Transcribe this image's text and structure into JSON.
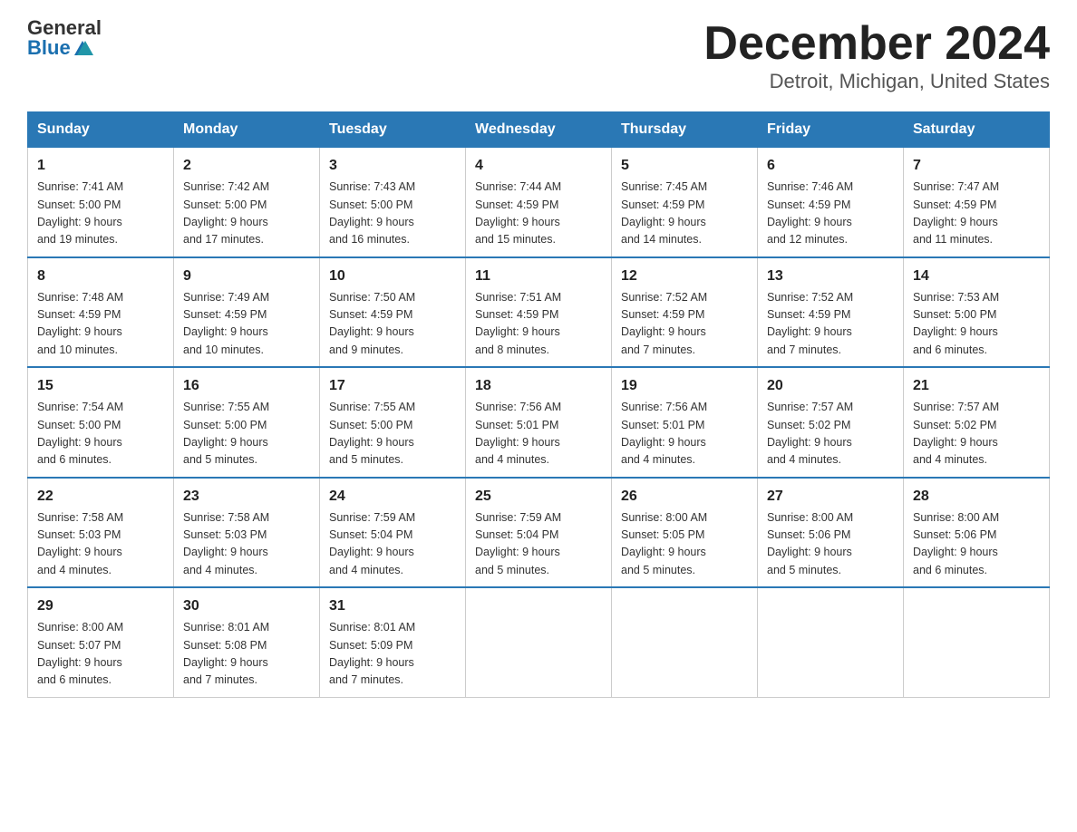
{
  "logo": {
    "general": "General",
    "blue": "Blue"
  },
  "title": "December 2024",
  "location": "Detroit, Michigan, United States",
  "days_of_week": [
    "Sunday",
    "Monday",
    "Tuesday",
    "Wednesday",
    "Thursday",
    "Friday",
    "Saturday"
  ],
  "weeks": [
    [
      {
        "day": "1",
        "sunrise": "7:41 AM",
        "sunset": "5:00 PM",
        "daylight": "9 hours and 19 minutes."
      },
      {
        "day": "2",
        "sunrise": "7:42 AM",
        "sunset": "5:00 PM",
        "daylight": "9 hours and 17 minutes."
      },
      {
        "day": "3",
        "sunrise": "7:43 AM",
        "sunset": "5:00 PM",
        "daylight": "9 hours and 16 minutes."
      },
      {
        "day": "4",
        "sunrise": "7:44 AM",
        "sunset": "4:59 PM",
        "daylight": "9 hours and 15 minutes."
      },
      {
        "day": "5",
        "sunrise": "7:45 AM",
        "sunset": "4:59 PM",
        "daylight": "9 hours and 14 minutes."
      },
      {
        "day": "6",
        "sunrise": "7:46 AM",
        "sunset": "4:59 PM",
        "daylight": "9 hours and 12 minutes."
      },
      {
        "day": "7",
        "sunrise": "7:47 AM",
        "sunset": "4:59 PM",
        "daylight": "9 hours and 11 minutes."
      }
    ],
    [
      {
        "day": "8",
        "sunrise": "7:48 AM",
        "sunset": "4:59 PM",
        "daylight": "9 hours and 10 minutes."
      },
      {
        "day": "9",
        "sunrise": "7:49 AM",
        "sunset": "4:59 PM",
        "daylight": "9 hours and 10 minutes."
      },
      {
        "day": "10",
        "sunrise": "7:50 AM",
        "sunset": "4:59 PM",
        "daylight": "9 hours and 9 minutes."
      },
      {
        "day": "11",
        "sunrise": "7:51 AM",
        "sunset": "4:59 PM",
        "daylight": "9 hours and 8 minutes."
      },
      {
        "day": "12",
        "sunrise": "7:52 AM",
        "sunset": "4:59 PM",
        "daylight": "9 hours and 7 minutes."
      },
      {
        "day": "13",
        "sunrise": "7:52 AM",
        "sunset": "4:59 PM",
        "daylight": "9 hours and 7 minutes."
      },
      {
        "day": "14",
        "sunrise": "7:53 AM",
        "sunset": "5:00 PM",
        "daylight": "9 hours and 6 minutes."
      }
    ],
    [
      {
        "day": "15",
        "sunrise": "7:54 AM",
        "sunset": "5:00 PM",
        "daylight": "9 hours and 6 minutes."
      },
      {
        "day": "16",
        "sunrise": "7:55 AM",
        "sunset": "5:00 PM",
        "daylight": "9 hours and 5 minutes."
      },
      {
        "day": "17",
        "sunrise": "7:55 AM",
        "sunset": "5:00 PM",
        "daylight": "9 hours and 5 minutes."
      },
      {
        "day": "18",
        "sunrise": "7:56 AM",
        "sunset": "5:01 PM",
        "daylight": "9 hours and 4 minutes."
      },
      {
        "day": "19",
        "sunrise": "7:56 AM",
        "sunset": "5:01 PM",
        "daylight": "9 hours and 4 minutes."
      },
      {
        "day": "20",
        "sunrise": "7:57 AM",
        "sunset": "5:02 PM",
        "daylight": "9 hours and 4 minutes."
      },
      {
        "day": "21",
        "sunrise": "7:57 AM",
        "sunset": "5:02 PM",
        "daylight": "9 hours and 4 minutes."
      }
    ],
    [
      {
        "day": "22",
        "sunrise": "7:58 AM",
        "sunset": "5:03 PM",
        "daylight": "9 hours and 4 minutes."
      },
      {
        "day": "23",
        "sunrise": "7:58 AM",
        "sunset": "5:03 PM",
        "daylight": "9 hours and 4 minutes."
      },
      {
        "day": "24",
        "sunrise": "7:59 AM",
        "sunset": "5:04 PM",
        "daylight": "9 hours and 4 minutes."
      },
      {
        "day": "25",
        "sunrise": "7:59 AM",
        "sunset": "5:04 PM",
        "daylight": "9 hours and 5 minutes."
      },
      {
        "day": "26",
        "sunrise": "8:00 AM",
        "sunset": "5:05 PM",
        "daylight": "9 hours and 5 minutes."
      },
      {
        "day": "27",
        "sunrise": "8:00 AM",
        "sunset": "5:06 PM",
        "daylight": "9 hours and 5 minutes."
      },
      {
        "day": "28",
        "sunrise": "8:00 AM",
        "sunset": "5:06 PM",
        "daylight": "9 hours and 6 minutes."
      }
    ],
    [
      {
        "day": "29",
        "sunrise": "8:00 AM",
        "sunset": "5:07 PM",
        "daylight": "9 hours and 6 minutes."
      },
      {
        "day": "30",
        "sunrise": "8:01 AM",
        "sunset": "5:08 PM",
        "daylight": "9 hours and 7 minutes."
      },
      {
        "day": "31",
        "sunrise": "8:01 AM",
        "sunset": "5:09 PM",
        "daylight": "9 hours and 7 minutes."
      },
      null,
      null,
      null,
      null
    ]
  ]
}
